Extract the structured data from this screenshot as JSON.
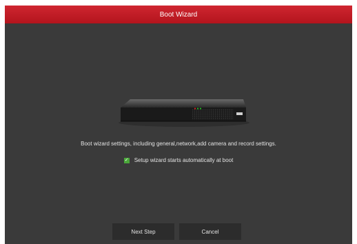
{
  "window": {
    "title": "Boot Wizard"
  },
  "main": {
    "device_icon": "nvr-device-icon",
    "description": "Boot wizard settings, including general,network,add camera and record settings.",
    "autostart": {
      "checked": true,
      "label": "Setup wizard starts automatically at boot",
      "check_glyph": "✓"
    }
  },
  "footer": {
    "next_label": "Next Step",
    "cancel_label": "Cancel"
  },
  "colors": {
    "title_bar": "#c21a24",
    "dialog_bg": "#3a3a3a",
    "button_bg": "#2c2c2c",
    "checkbox": "#4aa83a"
  }
}
